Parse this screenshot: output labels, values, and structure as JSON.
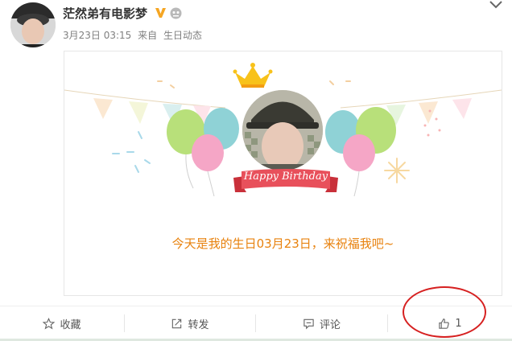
{
  "post": {
    "username": "茫然弟有电影梦",
    "date": "3月23日 03:15",
    "source_prefix": "来自",
    "source": "生日动态"
  },
  "card": {
    "banner_text": "Happy Birthday",
    "message": "今天是我的生日03月23日，来祝福我吧~"
  },
  "actions": {
    "favorite": "收藏",
    "repost": "转发",
    "comment": "评论",
    "like_count": "1"
  },
  "colors": {
    "accent_orange": "#e8820e",
    "banner_red": "#e8505b",
    "annotation_red": "#d62020"
  },
  "icons": [
    "verified-v-icon",
    "member-icon",
    "chevron-down-icon",
    "star-icon",
    "repost-icon",
    "comment-icon",
    "thumbs-up-icon",
    "crown-icon"
  ]
}
